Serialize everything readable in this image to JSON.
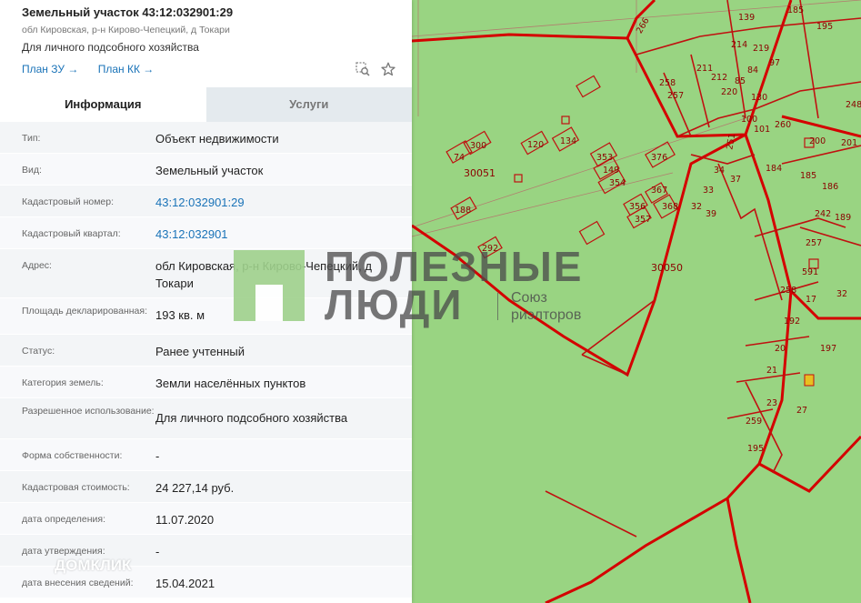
{
  "header": {
    "title": "Земельный участок 43:12:032901:29",
    "address": "обл Кировская, р-н Кирово-Чепецкий, д Токари",
    "purpose": "Для личного подсобного хозяйства",
    "link_plan_zu": "План ЗУ →",
    "link_plan_kk": "План КК →"
  },
  "tabs": [
    {
      "label": "Информация",
      "active": true
    },
    {
      "label": "Услуги",
      "active": false
    }
  ],
  "rows": [
    {
      "label": "Тип:",
      "value": "Объект недвижимости"
    },
    {
      "label": "Вид:",
      "value": "Земельный участок"
    },
    {
      "label": "Кадастровый номер:",
      "value": "43:12:032901:29"
    },
    {
      "label": "Кадастровый квартал:",
      "value": "43:12:032901"
    },
    {
      "label": "Адрес:",
      "value": "обл Кировская, р-н Кирово-Чепецкий, д Токари"
    },
    {
      "label": "Площадь декларированная:",
      "value": "193 кв. м"
    },
    {
      "label": "Статус:",
      "value": "Ранее учтенный"
    },
    {
      "label": "Категория земель:",
      "value": "Земли населённых пунктов"
    },
    {
      "label": "Разрешенное использование:",
      "value": "Для личного подсобного хозяйства"
    },
    {
      "label": "Форма собственности:",
      "value": "-"
    },
    {
      "label": "Кадастровая стоимость:",
      "value": "24 227,14 руб."
    },
    {
      "label": "дата определения:",
      "value": "11.07.2020"
    },
    {
      "label": "дата утверждения:",
      "value": "-"
    },
    {
      "label": "дата внесения сведений:",
      "value": "15.04.2021"
    }
  ],
  "watermark": {
    "line1": "ПОЛЕЗНЫЕ",
    "line2": "ЛЮДИ",
    "small1": "Союз",
    "small2": "риэлторов"
  },
  "domclick": "ДОМКЛИК",
  "map": {
    "labels": [
      "266",
      "139",
      "185",
      "195",
      "214",
      "219",
      "211",
      "212",
      "220",
      "85",
      "84",
      "97",
      "258",
      "257",
      "130",
      "100",
      "101",
      "260",
      "74",
      "300",
      "30051",
      "120",
      "134",
      "353",
      "149",
      "354",
      "376",
      "251",
      "200",
      "201",
      "184",
      "185",
      "186",
      "34",
      "37",
      "33",
      "32",
      "39",
      "188",
      "356",
      "357",
      "367",
      "368",
      "292",
      "30050",
      "242",
      "189",
      "257",
      "591",
      "258",
      "17",
      "32",
      "192",
      "197",
      "20",
      "21",
      "23",
      "27",
      "259",
      "195",
      "248"
    ],
    "colors": {
      "fill": "#99d482",
      "border": "#d40000",
      "thin": "#c04040"
    }
  }
}
